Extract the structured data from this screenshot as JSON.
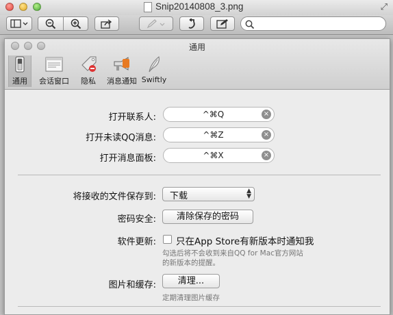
{
  "window": {
    "filename": "Snip20140808_3.png"
  },
  "toolbar": {
    "view_icon": "sidebar-icon",
    "zoom_out_icon": "zoom-out-icon",
    "zoom_in_icon": "zoom-in-icon",
    "share_icon": "share-icon",
    "pen_icon": "pen-icon",
    "rotate_icon": "rotate-icon",
    "edit_icon": "edit-icon",
    "search_placeholder": ""
  },
  "prefs": {
    "title": "通用",
    "tabs": [
      {
        "label": "通用",
        "icon": "switch-icon",
        "active": true
      },
      {
        "label": "会话窗口",
        "icon": "window-icon",
        "active": false
      },
      {
        "label": "隐私",
        "icon": "privacy-tag-icon",
        "active": false
      },
      {
        "label": "消息通知",
        "icon": "megaphone-icon",
        "active": false
      },
      {
        "label": "Swiftly",
        "icon": "feather-icon",
        "active": false
      }
    ],
    "shortcuts": [
      {
        "label": "打开联系人:",
        "value": "^⌘Q"
      },
      {
        "label": "打开未读QQ消息:",
        "value": "^⌘Z"
      },
      {
        "label": "打开消息面板:",
        "value": "^⌘X"
      }
    ],
    "save_files": {
      "label": "将接收的文件保存到:",
      "value": "下载"
    },
    "password": {
      "label": "密码安全:",
      "button": "清除保存的密码"
    },
    "update": {
      "label": "软件更新:",
      "checkbox_label": "只在App Store有新版本时通知我",
      "checked": false,
      "note_line1": "勾选后将不会收到来自QQ for Mac官方网站",
      "note_line2": "的新版本的提醒。"
    },
    "cache": {
      "label": "图片和缓存:",
      "button": "清理...",
      "note": "定期清理图片缓存"
    }
  }
}
